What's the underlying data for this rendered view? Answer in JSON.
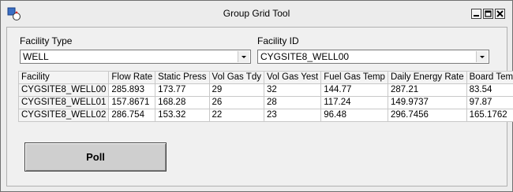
{
  "window": {
    "title": "Group Grid Tool",
    "icon": "app-icon"
  },
  "facility_type": {
    "label": "Facility Type",
    "value": "WELL"
  },
  "facility_id": {
    "label": "Facility ID",
    "value": "CYGSITE8_WELL00"
  },
  "grid": {
    "columns": [
      "Facility",
      "Flow Rate",
      "Static Press",
      "Vol Gas Tdy",
      "Vol Gas Yest",
      "Fuel Gas Temp",
      "Daily Energy Rate",
      "Board Temp"
    ],
    "rows": [
      [
        "CYGSITE8_WELL00",
        "285.893",
        "173.77",
        "29",
        "32",
        "144.77",
        "287.21",
        "83.54"
      ],
      [
        "CYGSITE8_WELL01",
        "157.8671",
        "168.28",
        "26",
        "28",
        "117.24",
        "149.9737",
        "97.87"
      ],
      [
        "CYGSITE8_WELL02",
        "286.754",
        "153.32",
        "22",
        "23",
        "96.48",
        "296.7456",
        "165.1762"
      ]
    ]
  },
  "poll_button": {
    "label": "Poll"
  }
}
